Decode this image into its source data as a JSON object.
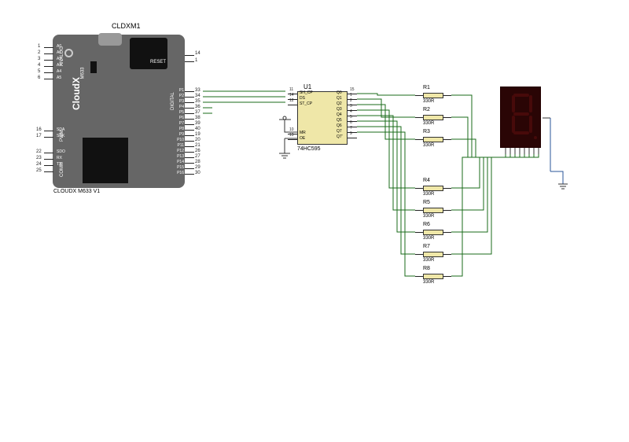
{
  "mcu": {
    "designator": "CLDXM1",
    "footnote": "CLOUDX M633 V1",
    "logo_text": "CloudX",
    "sub_text": "M633",
    "analog_label": "ANALOG",
    "pwm_label": "PWM",
    "comm_label": "COMM",
    "digital_label": "DIGITAL",
    "reset": "RESET",
    "analog_pins": [
      "A0",
      "A1",
      "A2",
      "A3",
      "A4",
      "A5"
    ],
    "analog_nums": [
      "1",
      "2",
      "3",
      "4",
      "5",
      "6"
    ],
    "comm_pins": [
      "SDA",
      "SCK",
      "SDO",
      "RX",
      "TX"
    ],
    "comm_nums": [
      "16",
      "17",
      "22",
      "23",
      "24",
      "25"
    ],
    "digital_left": [
      "P1",
      "P2",
      "P3",
      "P4",
      "P5",
      "P6",
      "P7",
      "P8",
      "P9",
      "P10",
      "P11",
      "P12",
      "P13",
      "P14",
      "P15",
      "P16"
    ],
    "digital_nums": [
      "33",
      "34",
      "35",
      "36",
      "37",
      "38",
      "39",
      "40",
      "19",
      "20",
      "21",
      "26",
      "27",
      "28",
      "29",
      "30"
    ],
    "top_nums": [
      "14",
      "1"
    ]
  },
  "ic": {
    "designator": "U1",
    "part": "74HC595",
    "left_pins_txt": [
      "SH_CP",
      "DS",
      "ST_CP",
      "",
      "MR",
      "OE"
    ],
    "left_nums": [
      "11",
      "14",
      "12",
      "",
      "10",
      "13"
    ],
    "right_txt": [
      "Q0",
      "Q1",
      "Q2",
      "Q3",
      "Q4",
      "Q5",
      "Q6",
      "Q7",
      "Q7'"
    ],
    "right_nums": [
      "15",
      "1",
      "2",
      "3",
      "4",
      "5",
      "6",
      "7",
      "9"
    ]
  },
  "resistors": {
    "names": [
      "R1",
      "R2",
      "R3",
      "R4",
      "R5",
      "R6",
      "R7",
      "R8"
    ],
    "value": "330R"
  }
}
